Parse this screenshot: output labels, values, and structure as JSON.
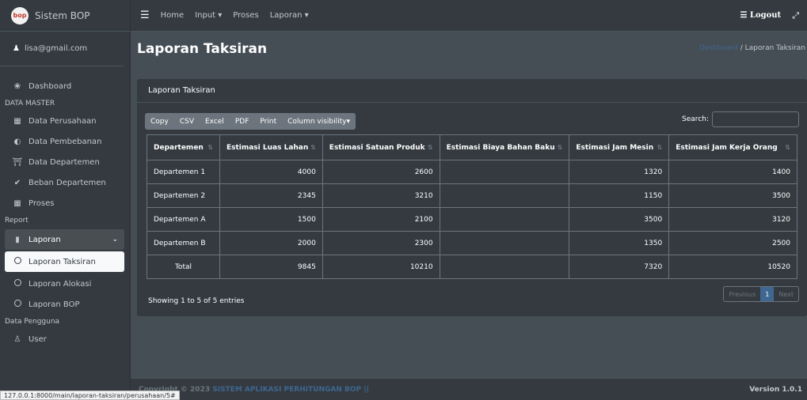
{
  "brand": {
    "logo": "bop",
    "title": "Sistem BOP"
  },
  "user": {
    "email": "lisa@gmail.com"
  },
  "sidebar": {
    "items": [
      {
        "label": "Dashboard",
        "icon": "palette-icon"
      },
      {
        "header": "DATA MASTER"
      },
      {
        "label": "Data Perusahaan",
        "icon": "building-icon"
      },
      {
        "label": "Data Pembebanan",
        "icon": "half-circle-icon"
      },
      {
        "label": "Data Departemen",
        "icon": "bank-icon"
      },
      {
        "label": "Beban Departemen",
        "icon": "check-icon"
      },
      {
        "label": "Proses",
        "icon": "grid-icon"
      },
      {
        "header": "Report"
      },
      {
        "label": "Laporan",
        "icon": "file-icon"
      },
      {
        "label": "Laporan Taksiran"
      },
      {
        "label": "Laporan Alokasi"
      },
      {
        "label": "Laporan BOP"
      },
      {
        "header": "Data Pengguna"
      },
      {
        "label": "User",
        "icon": "users-icon"
      }
    ]
  },
  "topbar": {
    "home": "Home",
    "input": "Input",
    "proses": "Proses",
    "laporan": "Laporan",
    "logout": "Logout"
  },
  "page": {
    "title": "Laporan Taksiran",
    "breadcrumb_link": "Dashboard",
    "breadcrumb_current": "Laporan Taksiran"
  },
  "card": {
    "title": "Laporan Taksiran",
    "buttons": [
      "Copy",
      "CSV",
      "Excel",
      "PDF",
      "Print",
      "Column visibility"
    ],
    "search_label": "Search:",
    "search_value": ""
  },
  "table": {
    "columns": [
      "Departemen",
      "Estimasi Luas Lahan",
      "Estimasi Satuan Produk",
      "Estimasi Biaya Bahan Baku",
      "Estimasi Jam Mesin",
      "Estimasi Jam Kerja Orang"
    ],
    "rows": [
      [
        "Departemen 1",
        "4000",
        "2600",
        "",
        "1320",
        "1400"
      ],
      [
        "Departemen 2",
        "2345",
        "3210",
        "",
        "1150",
        "3500"
      ],
      [
        "Departemen A",
        "1500",
        "2100",
        "",
        "3500",
        "3120"
      ],
      [
        "Departemen B",
        "2000",
        "2300",
        "",
        "1350",
        "2500"
      ],
      [
        "Total",
        "9845",
        "10210",
        "",
        "7320",
        "10520"
      ]
    ]
  },
  "pagination": {
    "info": "Showing 1 to 5 of 5 entries",
    "previous": "Previous",
    "current": "1",
    "next": "Next"
  },
  "footer": {
    "copyright": "Copyright © 2023",
    "app": "SISTEM APLIKASI PERHITUNGAN BOP ||",
    "version": "Version 1.0.1"
  },
  "statusbar": {
    "url": "127.0.0.1:8000/main/laporan-taksiran/perusahaan/5#"
  },
  "colors": {
    "accent": "#3f6791",
    "sidebar": "#343a40",
    "content": "#454d55"
  }
}
